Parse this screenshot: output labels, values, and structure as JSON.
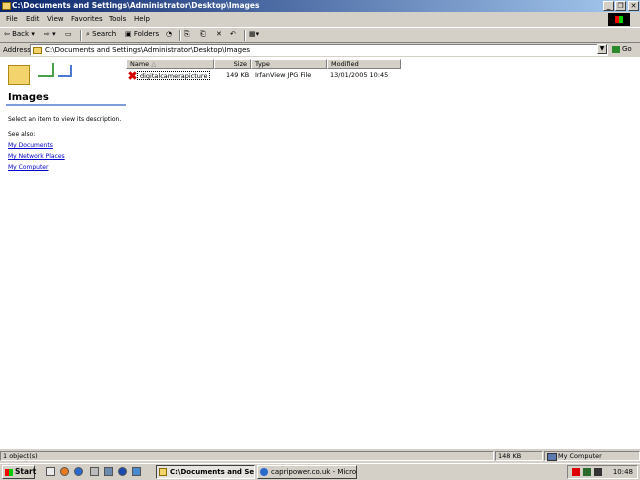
{
  "window": {
    "title": "C:\\Documents and Settings\\Administrator\\Desktop\\Images",
    "minimize": "_",
    "maximize": "❐",
    "close": "✕"
  },
  "menu": [
    "File",
    "Edit",
    "View",
    "Favorites",
    "Tools",
    "Help"
  ],
  "toolbar": {
    "back": "Back",
    "search": "Search",
    "folders": "Folders"
  },
  "address": {
    "label": "Address",
    "value": "C:\\Documents and Settings\\Administrator\\Desktop\\Images",
    "go": "Go"
  },
  "left_pane": {
    "title": "Images",
    "description": "Select an item to view its description.",
    "see_also": "See also:",
    "links": [
      "My Documents",
      "My Network Places",
      "My Computer"
    ]
  },
  "list": {
    "columns": [
      "Name",
      "Size",
      "Type",
      "Modified"
    ],
    "rows": [
      {
        "name": "digitalcamerapicture",
        "size": "149 KB",
        "type": "IrfanView JPG File",
        "modified": "13/01/2005 10:45"
      }
    ]
  },
  "status": {
    "objects": "1 object(s)",
    "size": "148 KB",
    "location": "My Computer"
  },
  "taskbar": {
    "start": "Start",
    "tasks": [
      "C:\\Documents and Set...",
      "capripower.co.uk - Micros..."
    ],
    "clock": "10:48"
  },
  "colors": {
    "titlebar": "#0a246a",
    "link": "#0000cc",
    "face": "#d4d0c8"
  }
}
